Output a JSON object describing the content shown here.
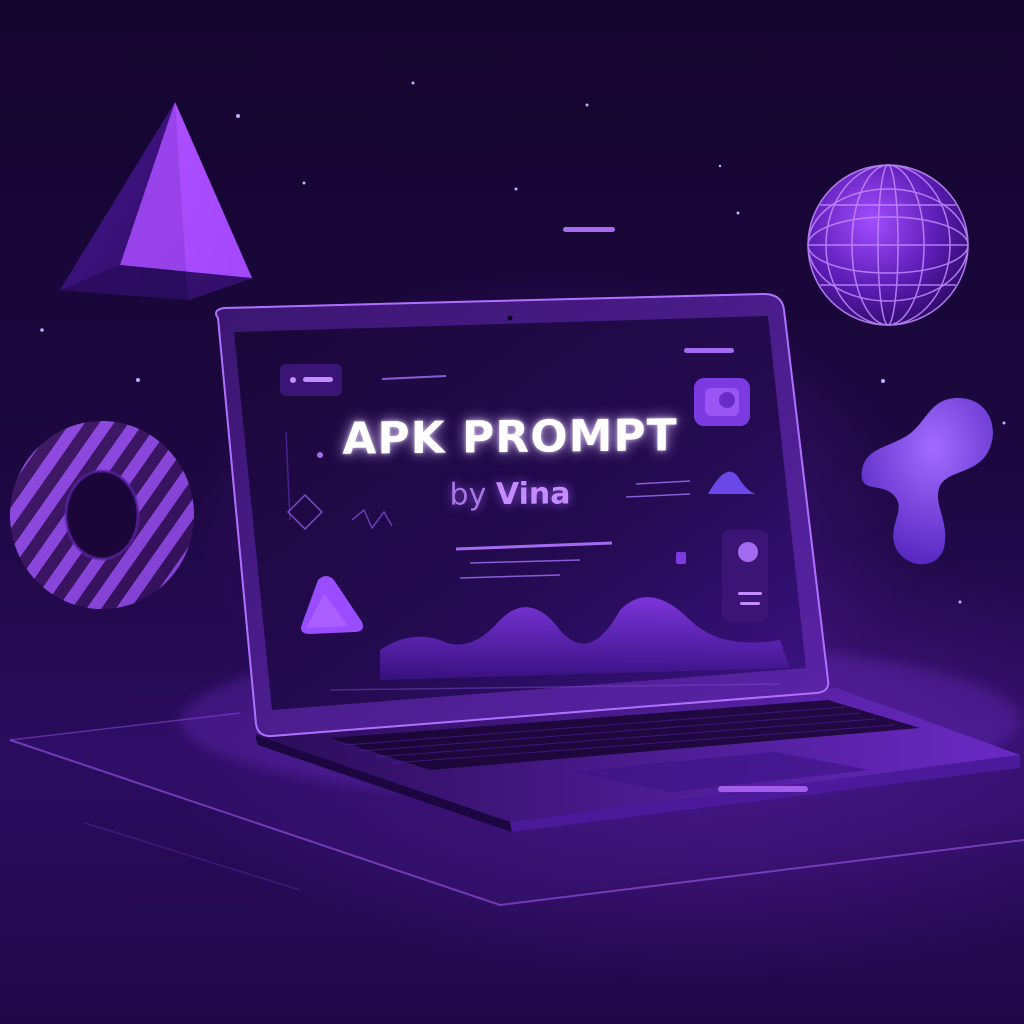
{
  "screen": {
    "title": "APK PROMPT",
    "subtitle_by": "by",
    "subtitle_name": "Vina"
  },
  "colors": {
    "background": "#1c0840",
    "accent": "#9b4dff",
    "glow": "#c48cff"
  },
  "objects": [
    "pyramid-shape",
    "striped-torus",
    "wireframe-globe",
    "blob-shape",
    "laptop"
  ]
}
